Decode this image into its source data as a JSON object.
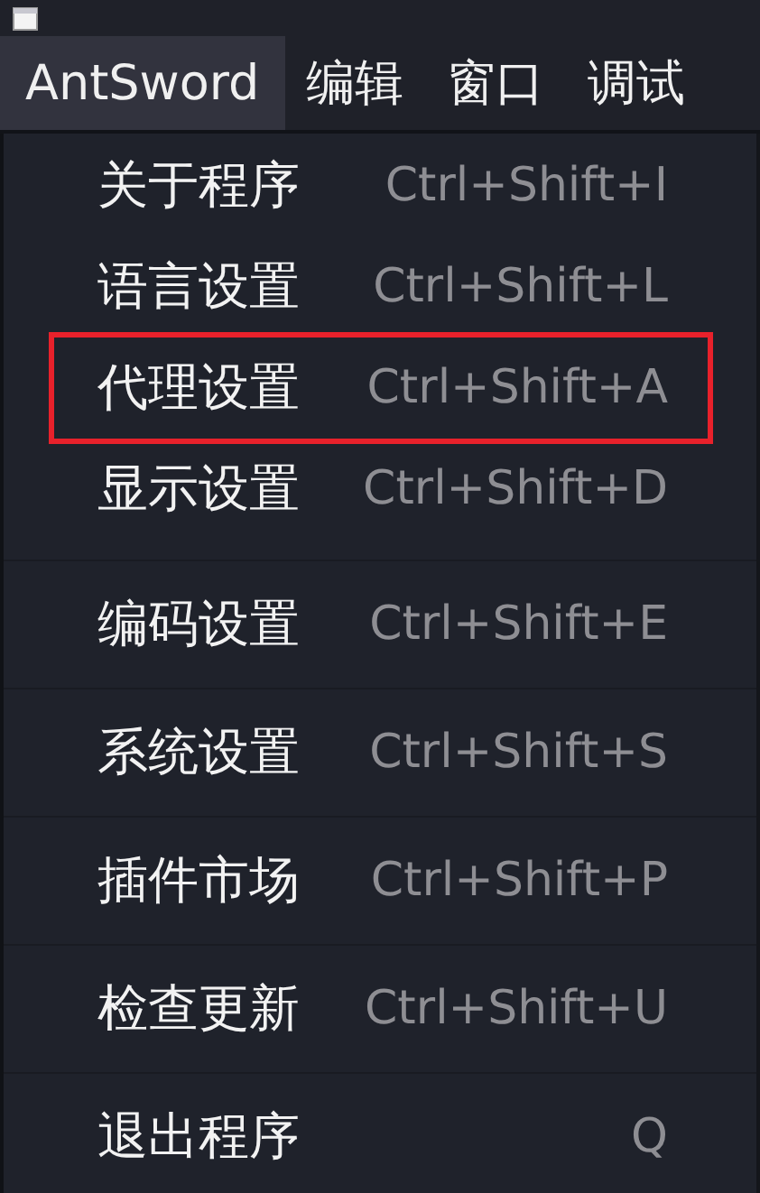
{
  "menubar": [
    {
      "label": "AntSword",
      "selected": true
    },
    {
      "label": "编辑",
      "selected": false
    },
    {
      "label": "窗口",
      "selected": false
    },
    {
      "label": "调试",
      "selected": false
    }
  ],
  "menu": {
    "groups": [
      {
        "items": [
          {
            "label": "关于程序",
            "shortcut": "Ctrl+Shift+I",
            "highlighted": false
          },
          {
            "label": "语言设置",
            "shortcut": "Ctrl+Shift+L",
            "highlighted": false
          },
          {
            "label": "代理设置",
            "shortcut": "Ctrl+Shift+A",
            "highlighted": true
          },
          {
            "label": "显示设置",
            "shortcut": "Ctrl+Shift+D",
            "highlighted": false
          }
        ]
      },
      {
        "items": [
          {
            "label": "编码设置",
            "shortcut": "Ctrl+Shift+E",
            "highlighted": false
          }
        ]
      },
      {
        "items": [
          {
            "label": "系统设置",
            "shortcut": "Ctrl+Shift+S",
            "highlighted": false
          }
        ]
      },
      {
        "items": [
          {
            "label": "插件市场",
            "shortcut": "Ctrl+Shift+P",
            "highlighted": false
          }
        ]
      },
      {
        "items": [
          {
            "label": "检查更新",
            "shortcut": "Ctrl+Shift+U",
            "highlighted": false
          }
        ]
      },
      {
        "items": [
          {
            "label": "退出程序",
            "shortcut": "Q",
            "highlighted": false
          }
        ]
      }
    ]
  }
}
